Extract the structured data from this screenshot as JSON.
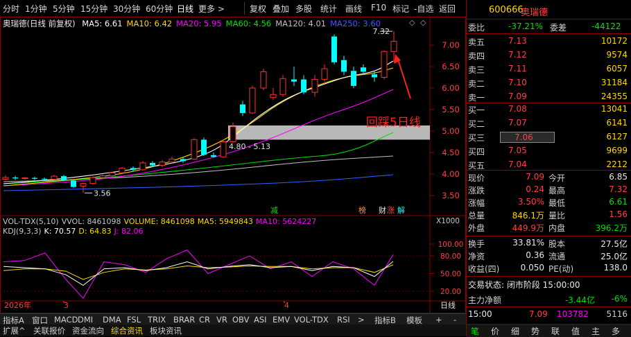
{
  "toolbar": {
    "periods": [
      "分时",
      "1分钟",
      "5分钟",
      "15分钟",
      "30分钟",
      "60分钟",
      "日线",
      "更多 >"
    ],
    "active_period": "日线",
    "actions": [
      "复权",
      "叠加",
      "多股",
      "统计",
      "画线",
      "F10",
      "标记",
      "-自选",
      "返回"
    ],
    "right_icon": "+"
  },
  "chart": {
    "title": "奥瑞德(日线 前复权)",
    "ma_labels": [
      {
        "text": "MA5: 6.61",
        "color": "#ffffff"
      },
      {
        "text": "MA10: 6.42",
        "color": "#ffd700"
      },
      {
        "text": "MA20: 5.95",
        "color": "#ff00ff"
      },
      {
        "text": "MA60: 4.56",
        "color": "#00e000"
      },
      {
        "text": "MA120: 4.01",
        "color": "#c0c0c0"
      },
      {
        "text": "MA250: 3.60",
        "color": "#3060ff"
      }
    ],
    "price_ticks": [
      "7.00",
      "6.50",
      "6.00",
      "5.50",
      "5.00",
      "4.50",
      "4.00",
      "3.50"
    ],
    "high_label": "7.32",
    "low_label": "3.56",
    "zone_label": "4.80 - 5.13",
    "annotation": "回踩5日线",
    "markers": {
      "jian": "减",
      "bang": "榜",
      "cai": "财",
      "zhang": "涨",
      "jie": "解"
    },
    "scale_label": "X1000",
    "dates": {
      "year": "2026年",
      "m3": "3",
      "m4": "4"
    },
    "period_tag": "日线"
  },
  "indicator": {
    "vol_labels": [
      {
        "text": "VOL-TDX(5,10)",
        "color": "#c8c8c8"
      },
      {
        "text": "VVOL: 8461098",
        "color": "#c8c8c8"
      },
      {
        "text": "VOLUME: 8461098",
        "color": "#ffd700"
      },
      {
        "text": "MA5: 5949843",
        "color": "#ffd700"
      },
      {
        "text": "MA10: 5624227",
        "color": "#ff00ff"
      }
    ],
    "kdj_labels": [
      {
        "text": "KDJ(9,3,3)",
        "color": "#c8c8c8"
      },
      {
        "text": "K: 70.57",
        "color": "#ffffff"
      },
      {
        "text": "D: 64.83",
        "color": "#ffd700"
      },
      {
        "text": "J: 82.06",
        "color": "#ff00ff"
      }
    ],
    "ticks": [
      "100.00",
      "80.00",
      "50.00",
      "20.00"
    ]
  },
  "bottom_tabs": [
    "指标A",
    "窗口",
    "MACD",
    "DMI",
    "DMA",
    "FSL",
    "TRIX",
    "BRAR",
    "CR",
    "VR",
    "OBV",
    "ASI",
    "EMV",
    "VOL-TDX",
    "RSI",
    ">"
  ],
  "bottom_right": [
    "指标B",
    "模板",
    "+",
    "-"
  ],
  "bottom_tabs2": [
    "扩展^",
    "关联报价",
    "资金流向",
    "综合资讯",
    "板块资讯"
  ],
  "quote": {
    "code": "600666",
    "name": "奥瑞德",
    "weibi_label": "委比",
    "weibi": "-37.21%",
    "weicha_label": "委差",
    "weicha": "-44122",
    "asks": [
      {
        "label": "卖五",
        "price": "7.13",
        "vol": "10172"
      },
      {
        "label": "卖四",
        "price": "7.12",
        "vol": "9574"
      },
      {
        "label": "卖三",
        "price": "7.11",
        "vol": "6057"
      },
      {
        "label": "卖二",
        "price": "7.10",
        "vol": "31184"
      },
      {
        "label": "卖一",
        "price": "7.09",
        "vol": "24355"
      }
    ],
    "bids": [
      {
        "label": "买一",
        "price": "7.08",
        "vol": "13041"
      },
      {
        "label": "买二",
        "price": "7.07",
        "vol": "6141"
      },
      {
        "label": "买三",
        "price": "7.06",
        "vol": "6127"
      },
      {
        "label": "买四",
        "price": "7.05",
        "vol": "9699"
      },
      {
        "label": "买五",
        "price": "7.04",
        "vol": "2212"
      }
    ],
    "stats": [
      {
        "l1": "现价",
        "v1": "7.09",
        "c1": "#ff4040",
        "l2": "今开",
        "v2": "6.85",
        "c2": "#e8e8e8"
      },
      {
        "l1": "涨跌",
        "v1": "0.24",
        "c1": "#ff4040",
        "l2": "最高",
        "v2": "7.32",
        "c2": "#ff4040"
      },
      {
        "l1": "涨幅",
        "v1": "3.50%",
        "c1": "#ff4040",
        "l2": "最低",
        "v2": "6.61",
        "c2": "#00e000"
      },
      {
        "l1": "总量",
        "v1": "846.1万",
        "c1": "#ffd700",
        "l2": "量比",
        "v2": "1.56",
        "c2": "#ff4040"
      },
      {
        "l1": "外盘",
        "v1": "449.9万",
        "c1": "#ff4040",
        "l2": "内盘",
        "v2": "396.2万",
        "c2": "#00e000"
      }
    ],
    "stats2": [
      {
        "l1": "换手",
        "v1": "33.81%",
        "l2": "股本",
        "v2": "27.5亿"
      },
      {
        "l1": "净资",
        "v1": "0.36",
        "l2": "流通",
        "v2": "25.0亿"
      },
      {
        "l1": "收益(四)",
        "v1": "0.050",
        "l2": "PE(动)",
        "v2": "138.0"
      }
    ],
    "trade_status": "交易状态: 闭市阶段 15:00:00",
    "main_flow_label": "主力净额",
    "main_flow": "-3.44亿",
    "main_flow_pct": "-6%",
    "last_time": "15:00",
    "last_price": "7.09",
    "last_vol": "103782",
    "last_num": "5116",
    "tabs": [
      "笔",
      "价",
      "细",
      "势",
      "联",
      "值",
      "主",
      "多"
    ]
  }
}
